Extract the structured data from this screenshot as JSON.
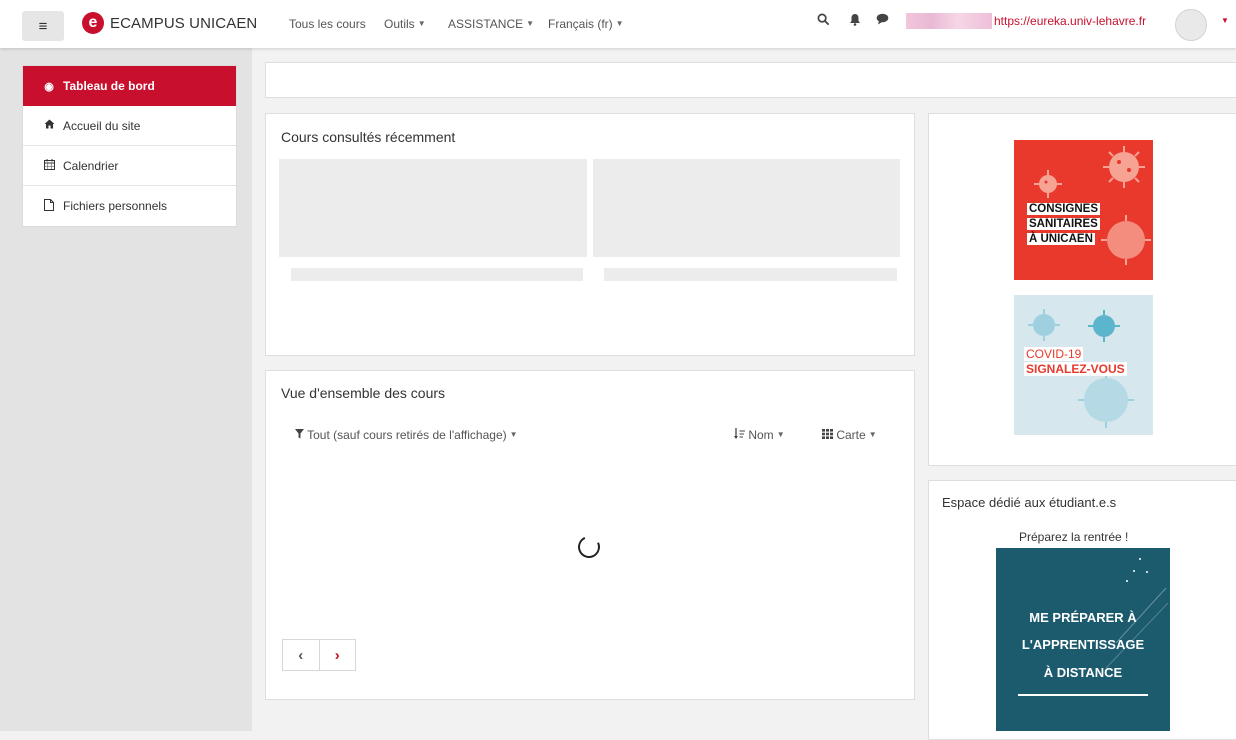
{
  "navbar": {
    "brand": "ECAMPUS UNICAEN",
    "brand_mark": "e",
    "menu": [
      "Tous les cours",
      "Outils",
      "ASSISTANCE",
      "Français (fr)"
    ],
    "user_url": "https://eureka.univ-lehavre.fr",
    "icons": [
      "menu-icon",
      "search-icon",
      "bell-icon",
      "chat-icon",
      "avatar",
      "chevron-down-icon"
    ]
  },
  "sidebar": {
    "items": [
      {
        "label": "Tableau de bord",
        "icon": "dashboard-icon",
        "active": true
      },
      {
        "label": "Accueil du site",
        "icon": "home-icon"
      },
      {
        "label": "Calendrier",
        "icon": "calendar-icon"
      },
      {
        "label": "Fichiers personnels",
        "icon": "file-icon"
      }
    ]
  },
  "recent": {
    "title": "Cours consultés récemment"
  },
  "overview": {
    "title": "Vue d'ensemble des cours",
    "filter": "Tout (sauf cours retirés de l'affichage)",
    "sort": "Nom",
    "view": "Carte"
  },
  "banners": {
    "consignes": [
      "CONSIGNES",
      "SANITAIRES",
      "À UNICAEN"
    ],
    "covid_line1": "COVID-19",
    "covid_line2": "SIGNALEZ-VOUS"
  },
  "students": {
    "title": "Espace dédié aux étudiant.e.s",
    "subtitle": "Préparez la rentrée !",
    "banner": [
      "ME PRÉPARER À",
      "L'APPRENTISSAGE",
      "À DISTANCE"
    ]
  },
  "colors": {
    "accent": "#c8102e",
    "banner_red": "#e8392c",
    "banner_teal": "#1c5a6e",
    "banner_light": "#d6e7ed"
  }
}
